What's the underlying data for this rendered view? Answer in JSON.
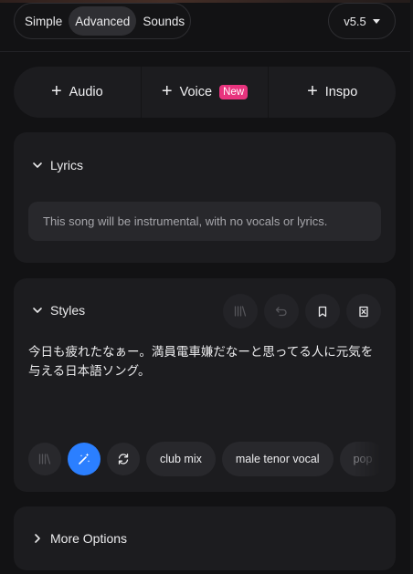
{
  "header": {
    "modes": [
      {
        "label": "Simple",
        "active": false
      },
      {
        "label": "Advanced",
        "active": true
      },
      {
        "label": "Sounds",
        "active": false
      }
    ],
    "version": "v5.5"
  },
  "add_bar": {
    "audio": "Audio",
    "voice": "Voice",
    "voice_badge": "New",
    "inspo": "Inspo"
  },
  "lyrics": {
    "title": "Lyrics",
    "placeholder": "This song will be instrumental, with no vocals or lyrics."
  },
  "styles": {
    "title": "Styles",
    "tools": [
      "library-icon",
      "undo-icon",
      "bookmark-icon",
      "clear-icon"
    ],
    "text": "今日も疲れたなぁー。満員電車嫌だなーと思ってる人に元気を与える日本語ソング。",
    "chip_icons": [
      "library-icon",
      "magic-wand-icon",
      "shuffle-icon"
    ],
    "chips": [
      "club mix",
      "male tenor vocal",
      "pop"
    ]
  },
  "more_options": {
    "title": "More Options"
  },
  "colors": {
    "accent": "#2b7fff",
    "badge": "#e8347e",
    "panel": "#1c1c1f",
    "background": "#121214"
  }
}
